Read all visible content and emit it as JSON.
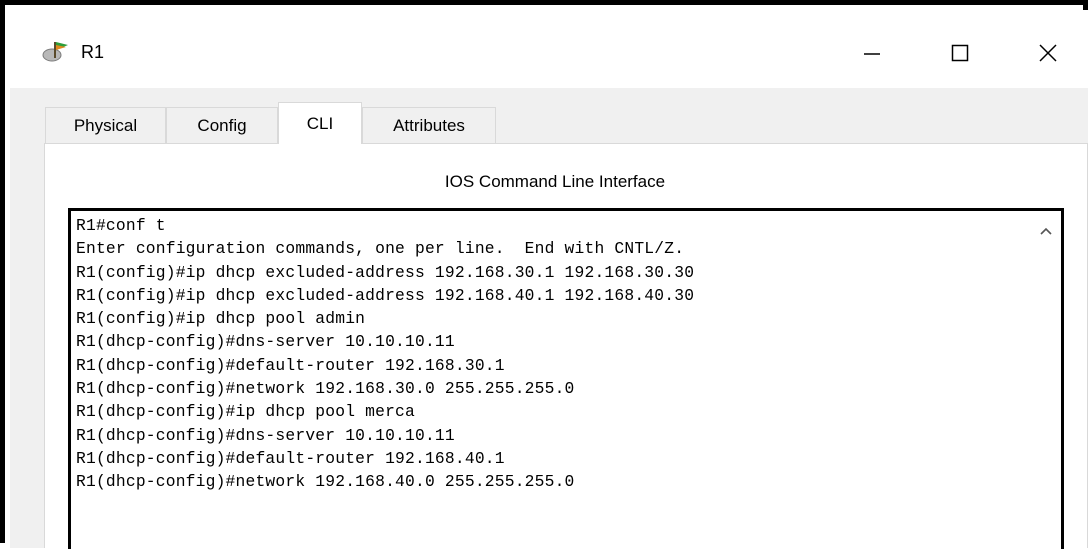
{
  "window": {
    "title": "R1",
    "controls": {
      "minimize": "—",
      "maximize": "☐",
      "close": "✕"
    }
  },
  "tabs": [
    {
      "label": "Physical",
      "active": false
    },
    {
      "label": "Config",
      "active": false
    },
    {
      "label": "CLI",
      "active": true
    },
    {
      "label": "Attributes",
      "active": false
    }
  ],
  "cli": {
    "heading": "IOS Command Line Interface",
    "lines": [
      "R1#conf t",
      "Enter configuration commands, one per line.  End with CNTL/Z.",
      "R1(config)#ip dhcp excluded-address 192.168.30.1 192.168.30.30",
      "R1(config)#ip dhcp excluded-address 192.168.40.1 192.168.40.30",
      "R1(config)#ip dhcp pool admin",
      "R1(dhcp-config)#dns-server 10.10.10.11",
      "R1(dhcp-config)#default-router 192.168.30.1",
      "R1(dhcp-config)#network 192.168.30.0 255.255.255.0",
      "R1(dhcp-config)#ip dhcp pool merca",
      "R1(dhcp-config)#dns-server 10.10.10.11",
      "R1(dhcp-config)#default-router 192.168.40.1",
      "R1(dhcp-config)#network 192.168.40.0 255.255.255.0"
    ]
  },
  "icons": {
    "app": "router-icon",
    "scroll": "scroll-up-arrow-icon"
  }
}
